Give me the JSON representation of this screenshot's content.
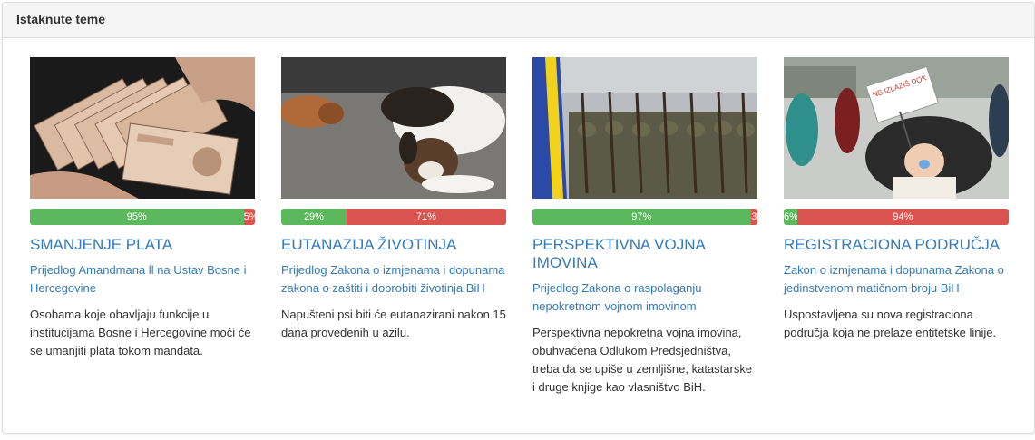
{
  "panel": {
    "heading": "Istaknute teme"
  },
  "colors": {
    "yes": "#5cb85c",
    "no": "#d9534f",
    "link": "#337ab7"
  },
  "cards": [
    {
      "image": "banknotes-photo",
      "yes_label": "95%",
      "no_label": "5%",
      "yes_fraction": 0.95,
      "title": "SMANJENJE PLATA",
      "subtitle": "Prijedlog Amandmana ll na Ustav Bosne i Hercegovine",
      "description": "Osobama koje obavljaju funkcije u institucijama Bosne i Hercegovine moći će se umanjiti plata tokom mandata."
    },
    {
      "image": "dogs-photo",
      "yes_label": "29%",
      "no_label": "71%",
      "yes_fraction": 0.29,
      "title": "EUTANAZIJA ŽIVOTINJA",
      "subtitle": "Prijedlog Zakona o izmjenama i dopunama zakona o zaštiti i dobrobiti životinja BiH",
      "description": "Napušteni psi biti će eutanazirani nakon 15 dana provedenih u azilu."
    },
    {
      "image": "soldiers-photo",
      "yes_label": "97%",
      "no_label": "3",
      "yes_fraction": 0.97,
      "title": "PERSPEKTIVNA VOJNA IMOVINA",
      "subtitle": "Prijedlog Zakona o raspolaganju nepokretnom vojnom imovinom",
      "description": "Perspektivna nepokretna vojna imovina, obuhvaćena Odlukom Predsjedništva, treba da se upiše u zemljišne, katastarske i druge knjige kao vlasništvo BiH."
    },
    {
      "image": "protest-baby-photo",
      "yes_label": "6%",
      "no_label": "94%",
      "yes_fraction": 0.06,
      "title": "REGISTRACIONA PODRUČJA",
      "subtitle": "Zakon o izmjenama i dopunama Zakona o jedinstvenom matičnom broju BiH",
      "description": "Uspostavljena su nova registraciona područja koja ne prelaze entitetske linije.",
      "sign_text": "NE IZLAZIŠ DOK NE DOBIJEM JMBG"
    }
  ]
}
